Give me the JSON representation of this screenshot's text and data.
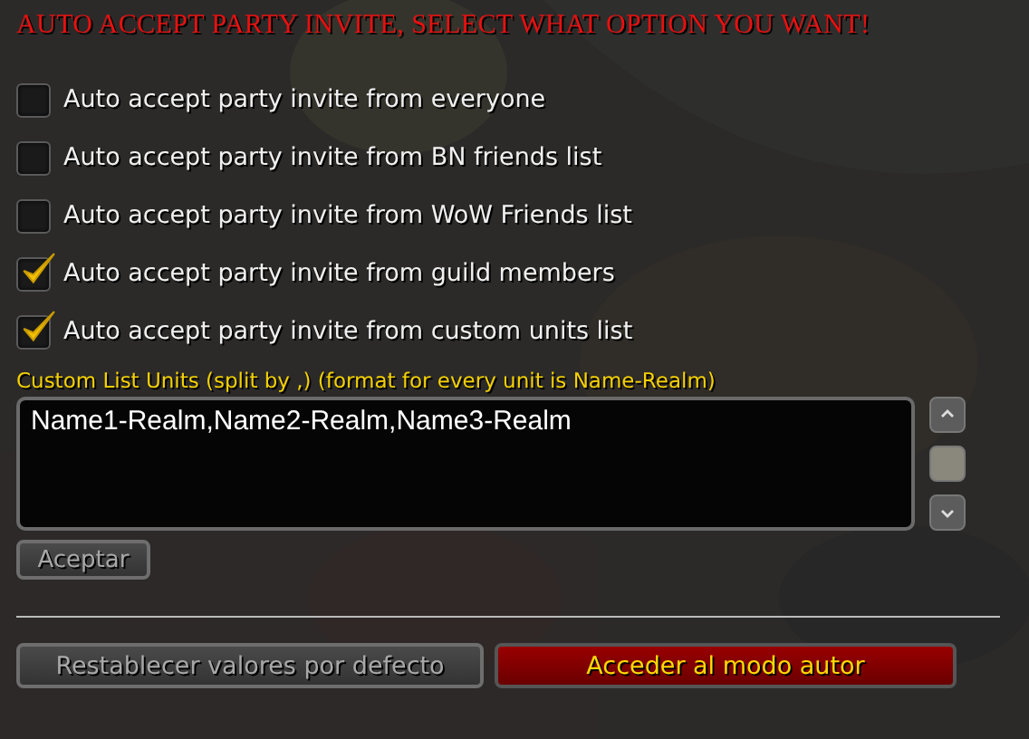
{
  "title": "AUTO ACCEPT PARTY INVITE, SELECT WHAT OPTION YOU WANT!",
  "options": [
    {
      "label": "Auto accept party invite from everyone",
      "checked": false
    },
    {
      "label": "Auto accept party invite from BN friends list",
      "checked": false
    },
    {
      "label": "Auto accept party invite from WoW Friends list",
      "checked": false
    },
    {
      "label": "Auto accept party invite from guild members",
      "checked": true
    },
    {
      "label": "Auto accept party invite from custom units list",
      "checked": true
    }
  ],
  "custom_list": {
    "label": "Custom List Units (split by ,) (format for every unit is Name-Realm)",
    "value": "Name1-Realm,Name2-Realm,Name3-Realm"
  },
  "accept_button": {
    "label": "Aceptar",
    "disabled": true
  },
  "footer_buttons": [
    {
      "label": "Restablecer valores por defecto",
      "kind": "gray",
      "disabled": true
    },
    {
      "label": "Acceder al modo autor",
      "kind": "red",
      "disabled": false
    }
  ]
}
